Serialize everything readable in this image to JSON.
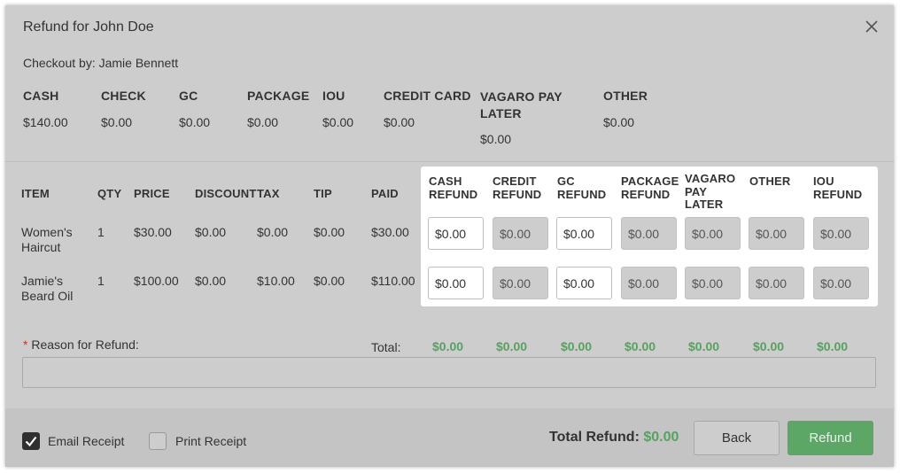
{
  "title": "Refund for John Doe",
  "checkout": "Checkout by: Jamie Bennett",
  "payments": [
    {
      "label": "CASH",
      "value": "$140.00"
    },
    {
      "label": "CHECK",
      "value": "$0.00"
    },
    {
      "label": "GC",
      "value": "$0.00"
    },
    {
      "label": "PACKAGE",
      "value": "$0.00"
    },
    {
      "label": "IOU",
      "value": "$0.00"
    },
    {
      "label": "CREDIT CARD",
      "value": "$0.00"
    },
    {
      "label": "VAGARO PAY LATER",
      "value": "$0.00"
    },
    {
      "label": "OTHER",
      "value": "$0.00"
    }
  ],
  "table": {
    "headers": [
      "ITEM",
      "QTY",
      "PRICE",
      "DISCOUNT",
      "TAX",
      "TIP",
      "PAID"
    ],
    "refund_headers": [
      "CASH REFUND",
      "CREDIT REFUND",
      "GC REFUND",
      "PACKAGE REFUND",
      "VAGARO PAY LATER",
      "OTHER",
      "IOU REFUND"
    ],
    "rows": [
      {
        "item": "Women's Haircut",
        "qty": "1",
        "price": "$30.00",
        "discount": "$0.00",
        "tax": "$0.00",
        "tip": "$0.00",
        "paid": "$30.00",
        "refunds": [
          "$0.00",
          "$0.00",
          "$0.00",
          "$0.00",
          "$0.00",
          "$0.00",
          "$0.00"
        ]
      },
      {
        "item": "Jamie's Beard Oil",
        "qty": "1",
        "price": "$100.00",
        "discount": "$0.00",
        "tax": "$10.00",
        "tip": "$0.00",
        "paid": "$110.00",
        "refunds": [
          "$0.00",
          "$0.00",
          "$0.00",
          "$0.00",
          "$0.00",
          "$0.00",
          "$0.00"
        ]
      }
    ],
    "editable_refunds": [
      true,
      false,
      true,
      false,
      false,
      false,
      false
    ],
    "total_label": "Total:",
    "totals": [
      "$0.00",
      "$0.00",
      "$0.00",
      "$0.00",
      "$0.00",
      "$0.00",
      "$0.00"
    ]
  },
  "reason": {
    "required_mark": "*",
    "label": "Reason for Refund:",
    "value": ""
  },
  "footer": {
    "email_receipt": {
      "label": "Email Receipt",
      "checked": true
    },
    "print_receipt": {
      "label": "Print Receipt",
      "checked": false
    },
    "total_refund_label": "Total Refund:",
    "total_refund_value": "$0.00",
    "back_label": "Back",
    "refund_label": "Refund"
  },
  "colors": {
    "accent_green": "#5ca765",
    "total_green": "#54a35e",
    "required_red": "#c0392b"
  },
  "icons": {
    "close": "close-icon",
    "checkbox_checked": "check-icon"
  }
}
